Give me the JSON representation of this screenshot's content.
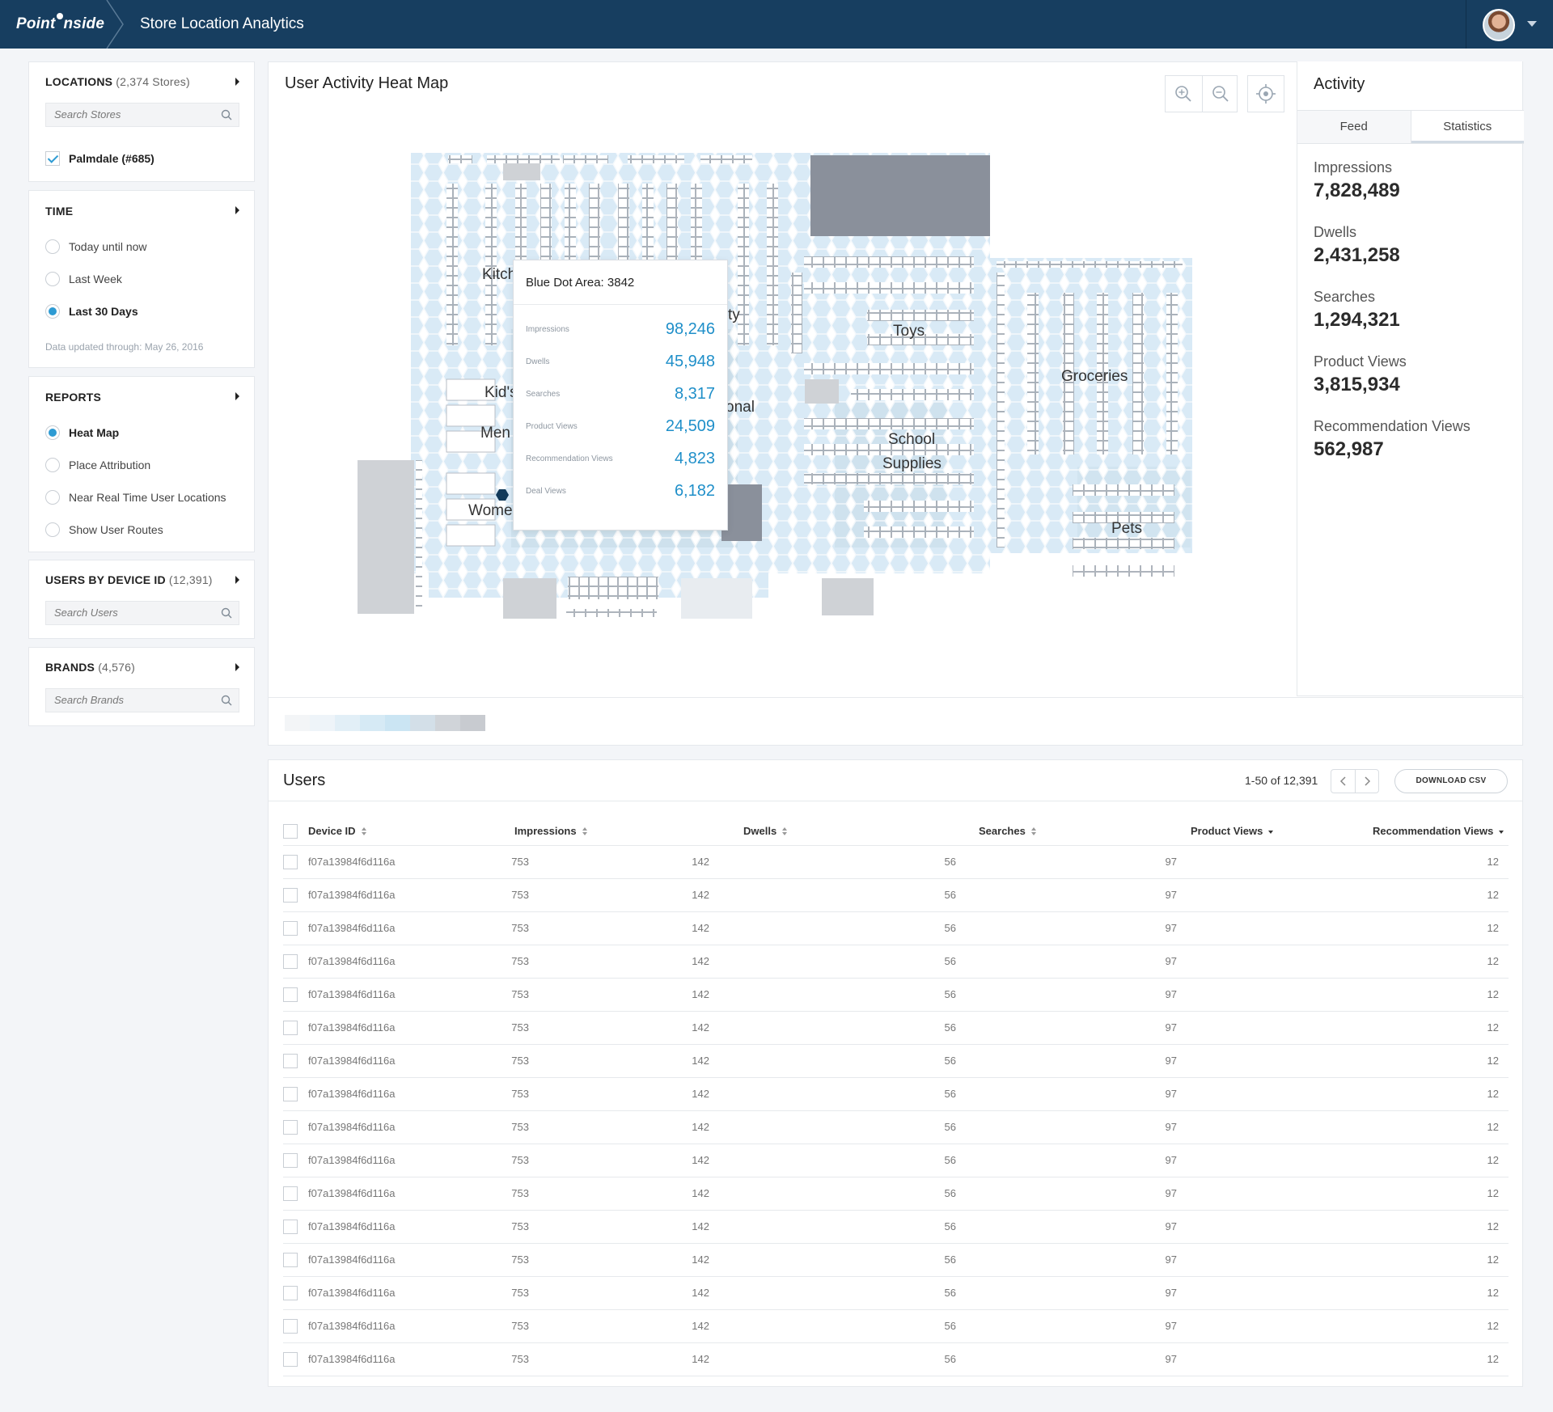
{
  "header": {
    "logo_left": "Point",
    "logo_right": "nside",
    "app_title": "Store Location Analytics"
  },
  "sidebar": {
    "locations": {
      "title": "LOCATIONS",
      "count": "(2,374 Stores)",
      "search_placeholder": "Search Stores",
      "selected_store": "Palmdale (#685)"
    },
    "time": {
      "title": "TIME",
      "options": [
        "Today until now",
        "Last Week",
        "Last 30 Days"
      ],
      "selected": "Last 30 Days",
      "note": "Data updated through: May 26, 2016"
    },
    "reports": {
      "title": "REPORTS",
      "options": [
        "Heat Map",
        "Place Attribution",
        "Near Real Time User Locations",
        "Show User Routes"
      ],
      "selected": "Heat Map"
    },
    "users": {
      "title": "USERS BY DEVICE ID",
      "count": "(12,391)",
      "search_placeholder": "Search Users"
    },
    "brands": {
      "title": "BRANDS",
      "count": "(4,576)",
      "search_placeholder": "Search Brands"
    }
  },
  "map": {
    "title": "User Activity Heat Map",
    "departments": [
      "Kitch",
      "Kid's",
      "Men",
      "Wome",
      "ty",
      "onal",
      "Toys",
      "School",
      "Supplies",
      "Groceries",
      "Pets"
    ],
    "tooltip": {
      "title": "Blue Dot Area: 3842",
      "rows": [
        {
          "label": "Impressions",
          "value": "98,246"
        },
        {
          "label": "Dwells",
          "value": "45,948"
        },
        {
          "label": "Searches",
          "value": "8,317"
        },
        {
          "label": "Product Views",
          "value": "24,509"
        },
        {
          "label": "Recommendation Views",
          "value": "4,823"
        },
        {
          "label": "Deal Views",
          "value": "6,182"
        }
      ]
    },
    "legend_colors": [
      "#f3f5f7",
      "#eef4f9",
      "#e2eff7",
      "#d6eaf5",
      "#cbe5f3",
      "#d3dfe8",
      "#d0d4d9",
      "#c8cbd0"
    ]
  },
  "activity": {
    "title": "Activity",
    "tabs": [
      "Feed",
      "Statistics"
    ],
    "active_tab": "Statistics",
    "stats": [
      {
        "label": "Impressions",
        "value": "7,828,489"
      },
      {
        "label": "Dwells",
        "value": "2,431,258"
      },
      {
        "label": "Searches",
        "value": "1,294,321"
      },
      {
        "label": "Product Views",
        "value": "3,815,934"
      },
      {
        "label": "Recommendation Views",
        "value": "562,987"
      }
    ]
  },
  "users_table": {
    "title": "Users",
    "pager": "1-50 of 12,391",
    "download_label": "DOWNLOAD CSV",
    "columns": [
      "Device ID",
      "Impressions",
      "Dwells",
      "Searches",
      "Product Views",
      "Recommendation Views"
    ],
    "rows": [
      [
        "f07a13984f6d116a",
        "753",
        "142",
        "56",
        "97",
        "12"
      ],
      [
        "f07a13984f6d116a",
        "753",
        "142",
        "56",
        "97",
        "12"
      ],
      [
        "f07a13984f6d116a",
        "753",
        "142",
        "56",
        "97",
        "12"
      ],
      [
        "f07a13984f6d116a",
        "753",
        "142",
        "56",
        "97",
        "12"
      ],
      [
        "f07a13984f6d116a",
        "753",
        "142",
        "56",
        "97",
        "12"
      ],
      [
        "f07a13984f6d116a",
        "753",
        "142",
        "56",
        "97",
        "12"
      ],
      [
        "f07a13984f6d116a",
        "753",
        "142",
        "56",
        "97",
        "12"
      ],
      [
        "f07a13984f6d116a",
        "753",
        "142",
        "56",
        "97",
        "12"
      ],
      [
        "f07a13984f6d116a",
        "753",
        "142",
        "56",
        "97",
        "12"
      ],
      [
        "f07a13984f6d116a",
        "753",
        "142",
        "56",
        "97",
        "12"
      ],
      [
        "f07a13984f6d116a",
        "753",
        "142",
        "56",
        "97",
        "12"
      ],
      [
        "f07a13984f6d116a",
        "753",
        "142",
        "56",
        "97",
        "12"
      ],
      [
        "f07a13984f6d116a",
        "753",
        "142",
        "56",
        "97",
        "12"
      ],
      [
        "f07a13984f6d116a",
        "753",
        "142",
        "56",
        "97",
        "12"
      ],
      [
        "f07a13984f6d116a",
        "753",
        "142",
        "56",
        "97",
        "12"
      ],
      [
        "f07a13984f6d116a",
        "753",
        "142",
        "56",
        "97",
        "12"
      ]
    ]
  }
}
